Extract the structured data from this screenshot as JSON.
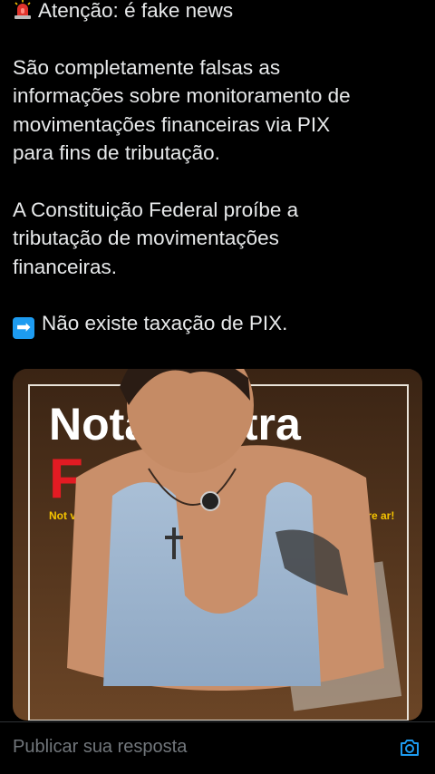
{
  "post": {
    "alert_line": "Atenção: é fake news",
    "paragraph_1": "São completamente falsas as\ninformações sobre monitoramento de\nmovimentações financeiras via PIX\npara fins de tributação.",
    "paragraph_2": "A Constituição Federal proíbe a\ntributação de movimentações\nfinanceiras.",
    "arrow_line": "Não existe taxação de PIX.",
    "alert_icon": "police-siren-emoji",
    "arrow_icon": "right-arrow-emoji"
  },
  "media": {
    "poster_title_line1": "Nota contra",
    "poster_title_line2": "Fake News",
    "poster_left_text": "Not ve",
    "poster_right_text": "pre ar!",
    "accent_color": "#e31b23"
  },
  "reply": {
    "placeholder": "Publicar sua resposta",
    "camera_icon": "camera-icon",
    "accent_color": "#1d9bf0"
  }
}
